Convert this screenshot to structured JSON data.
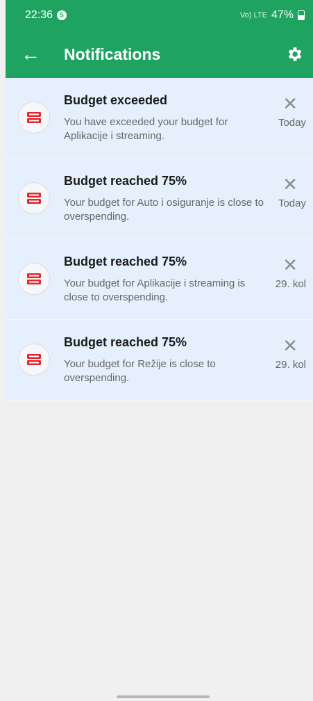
{
  "status_bar": {
    "time": "22:36",
    "notification_count": "5",
    "signal_text": "Vo) LTE",
    "battery": "47%"
  },
  "app_bar": {
    "title": "Notifications",
    "accent_color": "#1ea361"
  },
  "notifications": [
    {
      "title": "Budget exceeded",
      "body": "You have exceeded your budget for Aplikacije i streaming.",
      "date": "Today",
      "icon": "budget-icon"
    },
    {
      "title": "Budget reached 75%",
      "body": "Your budget for Auto i osiguranje is close to overspending.",
      "date": "Today",
      "icon": "budget-icon"
    },
    {
      "title": "Budget reached 75%",
      "body": "Your budget for Aplikacije i streaming is close to overspending.",
      "date": "29. kol",
      "icon": "budget-icon"
    },
    {
      "title": "Budget reached 75%",
      "body": "Your budget for Režije is close to overspending.",
      "date": "29. kol",
      "icon": "budget-icon"
    }
  ],
  "colors": {
    "item_background": "#e5f0fc",
    "icon_red": "#e3262b"
  }
}
